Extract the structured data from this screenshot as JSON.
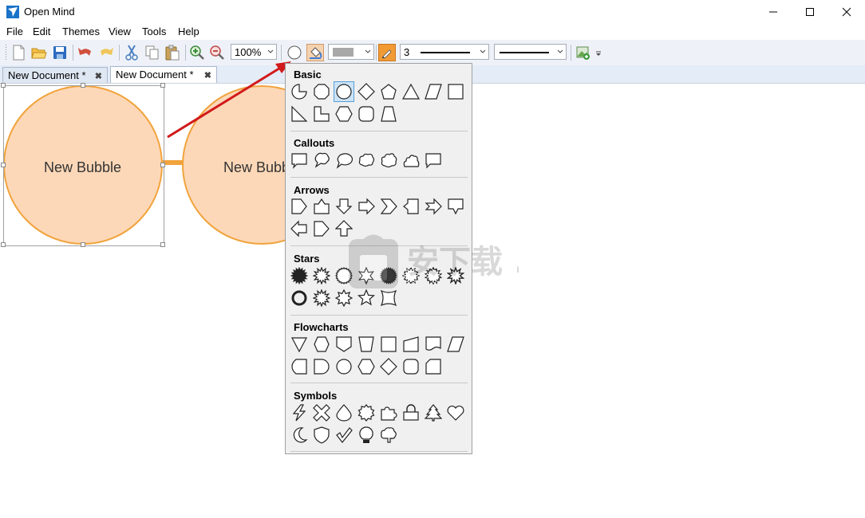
{
  "window": {
    "title": "Open Mind"
  },
  "menu": [
    "File",
    "Edit",
    "Themes",
    "View",
    "Tools",
    "Help"
  ],
  "toolbar": {
    "zoom": "100%",
    "line_width": "3"
  },
  "tabs": [
    {
      "label": "New Document *",
      "active": false
    },
    {
      "label": "New Document *",
      "active": true
    }
  ],
  "canvas": {
    "bubble1_label": "New Bubble",
    "bubble2_label": "New Bubble"
  },
  "shape_menu": {
    "basic": "Basic",
    "callouts": "Callouts",
    "arrows": "Arrows",
    "stars": "Stars",
    "flowcharts": "Flowcharts",
    "symbols": "Symbols"
  },
  "watermark": "安下载 .com",
  "colors": {
    "bubble_fill": "#fdd8b8",
    "bubble_stroke": "#f1a33c",
    "arrow": "#d11a1a",
    "selection": "#cce4f7"
  }
}
